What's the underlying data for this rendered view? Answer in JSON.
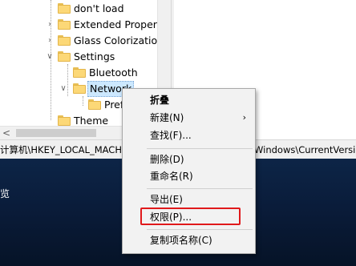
{
  "tree": {
    "items": [
      {
        "label": "don't load",
        "expandable": false
      },
      {
        "label": "Extended Propert",
        "expandable": true
      },
      {
        "label": "Glass Colorizatio",
        "expandable": true
      },
      {
        "label": "Settings",
        "expandable": true,
        "expanded": true
      },
      {
        "label": "Bluetooth",
        "expandable": false
      },
      {
        "label": "Network",
        "expandable": true,
        "expanded": true,
        "selected": true
      },
      {
        "label": "Pref",
        "expandable": false
      },
      {
        "label": "Theme",
        "expandable": false
      }
    ],
    "scroll_left": "<"
  },
  "status_bar": {
    "path_left": "计算机\\HKEY_LOCAL_MACH",
    "path_right": "Windows\\CurrentVersi"
  },
  "desktop": {
    "partial_text": "览"
  },
  "context_menu": {
    "items": [
      {
        "label": "折叠",
        "bold": true
      },
      {
        "label": "新建(N)",
        "submenu": true,
        "submenu_arrow": "›"
      },
      {
        "label": "查找(F)..."
      },
      {
        "label": "删除(D)"
      },
      {
        "label": "重命名(R)"
      },
      {
        "label": "导出(E)"
      },
      {
        "label": "权限(P)...",
        "highlighted": true
      },
      {
        "label": "复制项名称(C)"
      }
    ]
  },
  "colors": {
    "highlight_border": "#e0191b",
    "selection_bg": "#cce8ff",
    "folder": "#fcd877"
  }
}
